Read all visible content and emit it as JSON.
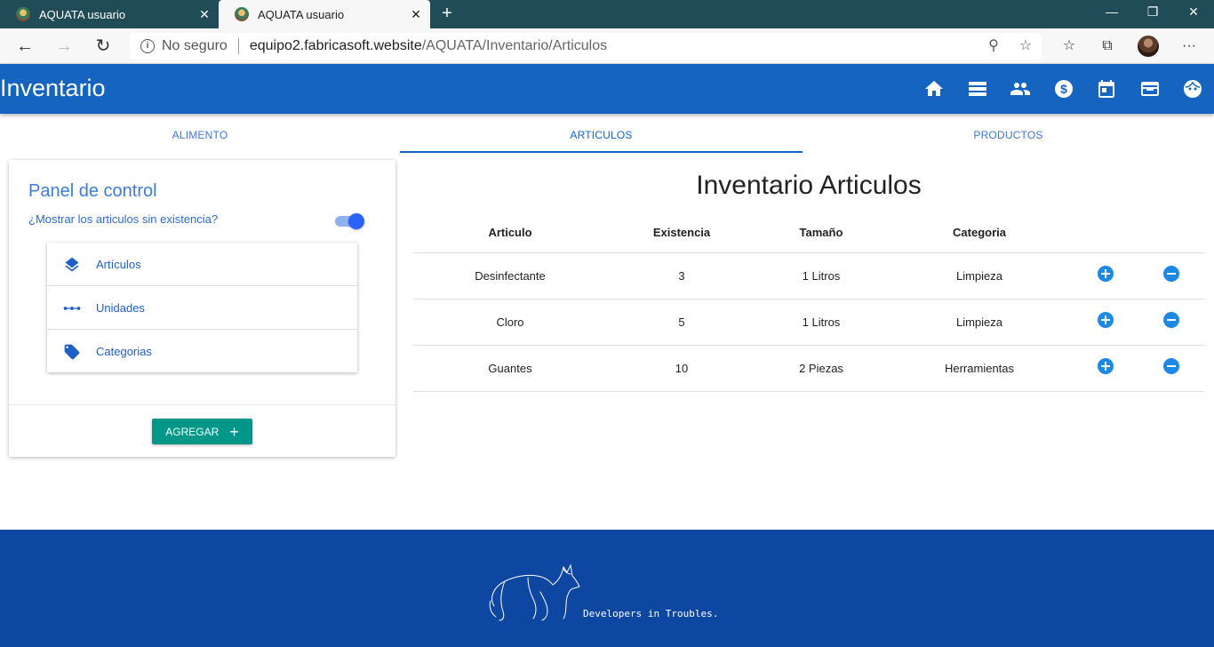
{
  "browser": {
    "tabs": [
      {
        "label": "AQUATA usuario",
        "active": false
      },
      {
        "label": "AQUATA usuario",
        "active": true
      }
    ],
    "address": {
      "security": "No seguro",
      "host": "equipo2.fabricasoft.website",
      "path": "/AQUATA/Inventario/Articulos"
    },
    "window_controls": {
      "minimize": "—",
      "restore": "❐",
      "close": "✕"
    }
  },
  "appbar": {
    "title": "Inventario",
    "icons": [
      "home-icon",
      "storage-icon",
      "people-icon",
      "money-icon",
      "calendar-icon",
      "card-icon",
      "face-icon"
    ]
  },
  "tabs": [
    {
      "label": "ALIMENTO",
      "selected": false
    },
    {
      "label": "ARTICULOS",
      "selected": true
    },
    {
      "label": "PRODUCTOS",
      "selected": false
    }
  ],
  "panel": {
    "title": "Panel de control",
    "question": "¿Mostrar los articulos sin existencia?",
    "toggle_on": true,
    "menu": [
      {
        "label": "Artículos",
        "icon": "layers-icon"
      },
      {
        "label": "Unidades",
        "icon": "dots-icon"
      },
      {
        "label": "Categorias",
        "icon": "tag-icon"
      }
    ],
    "add_button": "AGREGAR",
    "add_icon": "+"
  },
  "inventory": {
    "title": "Inventario Articulos",
    "columns": [
      "Articulo",
      "Existencia",
      "Tamaño",
      "Categoria"
    ],
    "rows": [
      {
        "articulo": "Desinfectante",
        "existencia": "3",
        "tamano": "1 Litros",
        "categoria": "Limpieza"
      },
      {
        "articulo": "Cloro",
        "existencia": "5",
        "tamano": "1 Litros",
        "categoria": "Limpieza"
      },
      {
        "articulo": "Guantes",
        "existencia": "10",
        "tamano": "2 Piezas",
        "categoria": "Herramientas"
      }
    ]
  },
  "footer": {
    "text": "Developers in Troubles."
  },
  "colors": {
    "appbar": "#1565c0",
    "footer": "#0d47a1",
    "add_button": "#009688",
    "action_buttons": "#1e88e5"
  }
}
